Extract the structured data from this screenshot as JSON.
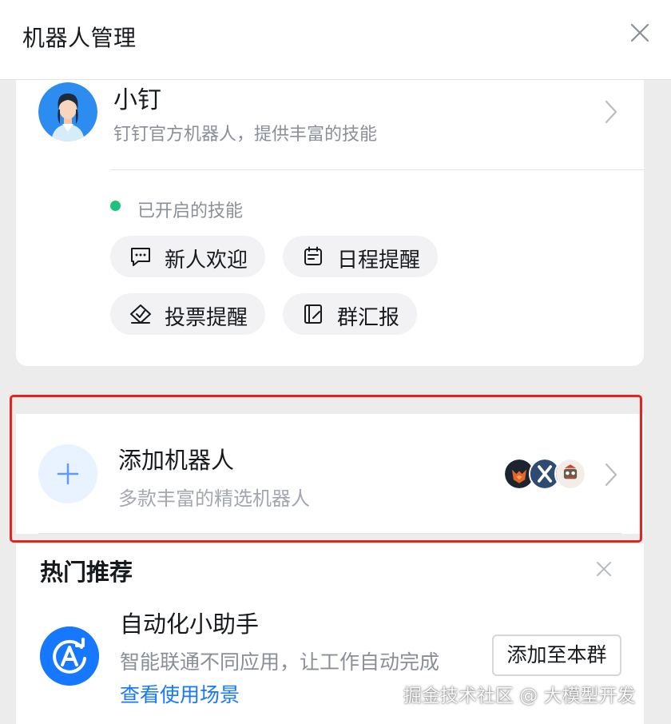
{
  "header": {
    "title": "机器人管理",
    "close_icon": "close-icon"
  },
  "bot": {
    "name": "小钉",
    "description": "钉钉官方机器人，提供丰富的技能",
    "status_label": "已开启的技能",
    "status_color": "#1fc27d",
    "skills": [
      {
        "label": "新人欢迎",
        "icon": "message-icon"
      },
      {
        "label": "日程提醒",
        "icon": "calendar-icon"
      },
      {
        "label": "投票提醒",
        "icon": "vote-icon"
      },
      {
        "label": "群汇报",
        "icon": "report-icon"
      }
    ]
  },
  "add_robot": {
    "title": "添加机器人",
    "description": "多款丰富的精选机器人",
    "icon": "plus-icon",
    "avatars": [
      "fox-avatar",
      "x-avatar",
      "cartoon-avatar"
    ]
  },
  "recommend": {
    "title": "热门推荐",
    "item": {
      "name": "自动化小助手",
      "description": "智能联通不同应用，让工作自动完成",
      "link": "查看使用场景",
      "button": "添加至本群",
      "icon": "automation-icon"
    }
  },
  "watermark": "掘金技术社区 @ 大模型开发",
  "colors": {
    "accent": "#1677ff",
    "highlight_border": "#e8211c",
    "background": "#ececed"
  }
}
